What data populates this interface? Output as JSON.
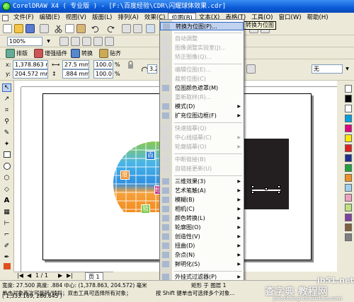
{
  "window": {
    "title": "CorelDRAW X4 ( 专业版 ) - [F:\\百度经验\\CDR\\闪耀球体效果.cdr]"
  },
  "menubar": [
    "文件(F)",
    "编辑(E)",
    "视图(V)",
    "版面(L)",
    "排列(A)",
    "效果(C)",
    "位图(B)",
    "文本(X)",
    "表格(T)",
    "工具(O)",
    "窗口(W)",
    "帮助(H)"
  ],
  "toolbar": {
    "zoom": "100%",
    "tooltip": "转换为位图",
    "buttons": [
      "排版",
      "增强插件",
      "转换",
      "贴齐"
    ]
  },
  "propbar": {
    "x": "1,378.863 mm",
    "y": "204.572 mm",
    "w": "27.5 mm",
    "h": ".884 mm",
    "sx": "100.0",
    "sy": "100.0",
    "rot": "3.2",
    "outline": "1.8",
    "pct": "%",
    "none": "无"
  },
  "dropdown": {
    "items": [
      {
        "label": "转换为位图(P)...",
        "state": "hl"
      },
      {
        "label": "自动调整",
        "state": "dis"
      },
      {
        "label": "图像调整实验室(J)...",
        "state": "dis"
      },
      {
        "label": "矫正图像(Q)...",
        "state": "dis"
      },
      {
        "label": "编辑位图(E)...",
        "state": "dis"
      },
      {
        "label": "裁剪位图(C)",
        "state": "dis"
      },
      {
        "label": "位图颜色遮罩(M)",
        "state": ""
      },
      {
        "label": "重新取样(R)...",
        "state": "dis"
      },
      {
        "label": "模式(D)",
        "state": "",
        "sub": true
      },
      {
        "label": "扩充位图边框(F)",
        "state": "",
        "sub": true
      },
      {
        "label": "快速描摹(Q)",
        "state": "dis"
      },
      {
        "label": "中心线描摹(C)",
        "state": "dis",
        "sub": true
      },
      {
        "label": "轮廓描摹(O)",
        "state": "dis",
        "sub": true
      },
      {
        "label": "中断链接(B)",
        "state": "dis"
      },
      {
        "label": "自链接更新(U)",
        "state": "dis"
      },
      {
        "label": "三维效果(3)",
        "state": "",
        "sub": true
      },
      {
        "label": "艺术笔触(A)",
        "state": "",
        "sub": true
      },
      {
        "label": "模糊(B)",
        "state": "",
        "sub": true
      },
      {
        "label": "相机(C)",
        "state": "",
        "sub": true
      },
      {
        "label": "颜色转换(L)",
        "state": "",
        "sub": true
      },
      {
        "label": "轮廓图(O)",
        "state": "",
        "sub": true
      },
      {
        "label": "创造性(V)",
        "state": "",
        "sub": true
      },
      {
        "label": "扭曲(D)",
        "state": "",
        "sub": true
      },
      {
        "label": "杂点(N)",
        "state": "",
        "sub": true
      },
      {
        "label": "鲜明化(S)",
        "state": "",
        "sub": true
      },
      {
        "label": "外挂式过滤器(P)",
        "state": "",
        "sub": true
      }
    ]
  },
  "sphere_labels": [
    "百",
    "度",
    "经",
    "验"
  ],
  "pages": {
    "nav": "1 / 1",
    "tab": "页 1"
  },
  "status": {
    "line1": "宽度: 27.500  高度: .884  中心: (1,378.863, 204.572) 毫米",
    "line2": "单击对象两次可旋转/倾斜；双击工具可选择所有对象；",
    "line3": "( 1,333.169, 286.645 )",
    "line4": "按 Shift 键单击可选择多个对象...",
    "layer": "矩形 于 图层 1",
    "layer2": "单击对象两次可旋转/倾斜"
  },
  "watermark": {
    "site": "jb51.net",
    "brand": "查字典 教程网",
    "url": "jiaocheng.chazidian.com"
  }
}
